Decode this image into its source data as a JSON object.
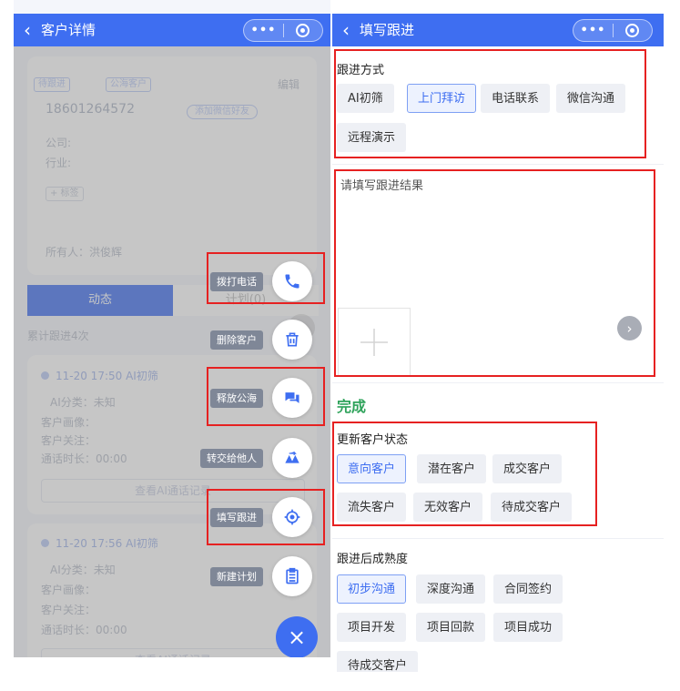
{
  "left": {
    "title": "客户详情",
    "back_icon": "chevron-left-icon",
    "capsule": {
      "more": "•••",
      "close_icon": "target-circle-icon"
    },
    "background": {
      "tag_status": "待跟进",
      "tag_public": "公海客户",
      "edit": "编辑",
      "phone": "18601264572",
      "wechat_chip": "添加微信好友",
      "company": "公司:",
      "industry": "行业:",
      "tag_add": "+ 标签",
      "owner": "所有人：洪俊辉",
      "tab_active": "动态",
      "tab_plan": "计划(0)",
      "total": "累计跟进4次",
      "record1_time": "11-20 17:50  AI初筛",
      "record1_lines": [
        "AI分类：未知",
        "客户画像：",
        "客户关注：",
        "通话时长：00:00"
      ],
      "record1_btn": "查看AI通话记录",
      "record2_time": "11-20 17:56  AI初筛",
      "record2_lines": [
        "AI分类：未知",
        "客户画像：",
        "客户关注：",
        "通话时长：00:00"
      ],
      "record2_btn": "查看AI通话记录"
    },
    "menu": [
      {
        "label": "拨打电话",
        "icon": "phone-icon"
      },
      {
        "label": "删除客户",
        "icon": "trash-icon"
      },
      {
        "label": "释放公海",
        "icon": "chat-bubbles-icon"
      },
      {
        "label": "转交给他人",
        "icon": "transfer-people-icon"
      },
      {
        "label": "填写跟进",
        "icon": "target-icon"
      },
      {
        "label": "新建计划",
        "icon": "clipboard-list-icon"
      }
    ],
    "close_fab": "×"
  },
  "right": {
    "title": "填写跟进",
    "back_icon": "chevron-left-icon",
    "capsule": {
      "more": "•••",
      "close_icon": "target-circle-icon"
    },
    "method": {
      "title": "跟进方式",
      "options": [
        "AI初筛",
        "上门拜访",
        "电话联系",
        "微信沟通",
        "远程演示"
      ],
      "selected": "上门拜访"
    },
    "result": {
      "placeholder": "请填写跟进结果"
    },
    "upload_icon": "plus-icon",
    "next_icon": "chevron-right-icon",
    "done": "完成",
    "status": {
      "title": "更新客户状态",
      "options": [
        "意向客户",
        "潜在客户",
        "成交客户",
        "流失客户",
        "无效客户",
        "待成交客户"
      ],
      "selected": "意向客户"
    },
    "maturity": {
      "title": "跟进后成熟度",
      "options": [
        "初步沟通",
        "深度沟通",
        "合同签约",
        "项目开发",
        "项目回款",
        "项目成功",
        "待成交客户"
      ],
      "selected": "初步沟通"
    }
  },
  "colors": {
    "primary": "#3e6ef1",
    "done_green": "#2fa35b",
    "highlight_red": "#e62121"
  }
}
